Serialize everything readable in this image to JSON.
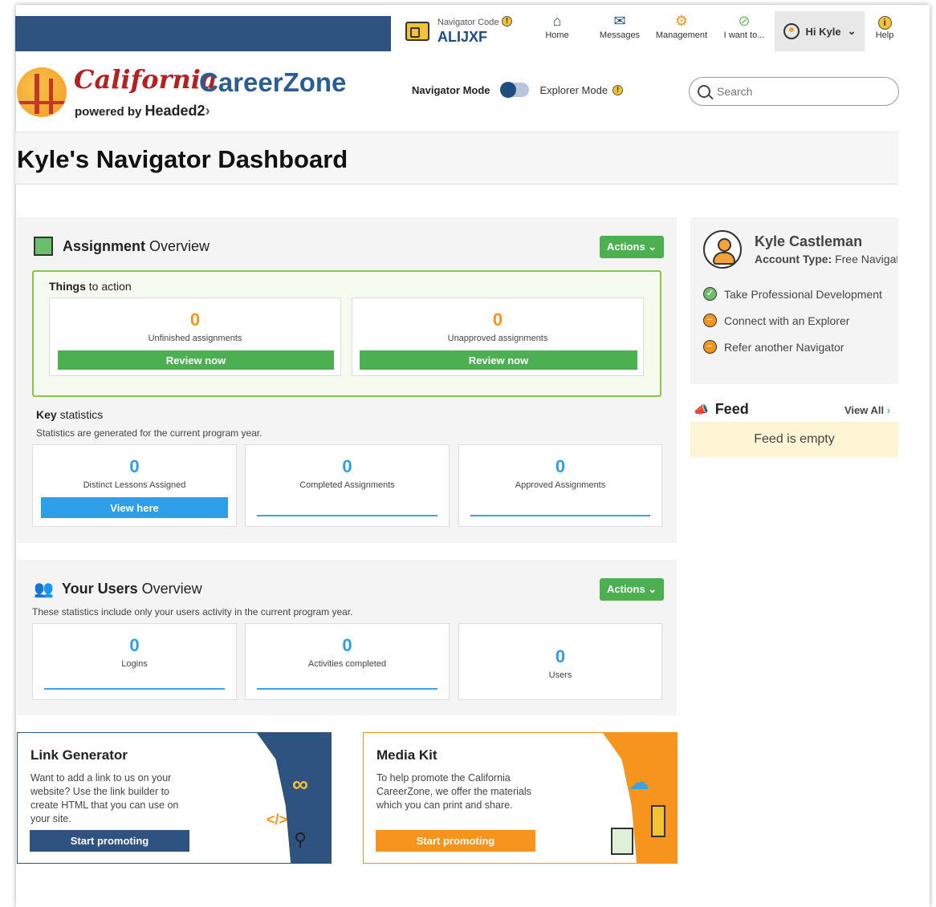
{
  "nav": {
    "code_label": "Navigator Code",
    "code_value": "ALIJXF",
    "home": "Home",
    "messages": "Messages",
    "management": "Management",
    "iwant": "I want to...",
    "greeting": "Hi Kyle",
    "help": "Help"
  },
  "brand": {
    "california": "California",
    "careerzone": "CareerZone",
    "powered_by": "powered by",
    "headed2": "Headed2"
  },
  "modes": {
    "navigator": "Navigator Mode",
    "explorer": "Explorer Mode"
  },
  "search": {
    "placeholder": "Search"
  },
  "page_title": "Kyle's Navigator Dashboard",
  "assignment": {
    "title_bold": "Assignment",
    "title_rest": "Overview",
    "actions": "Actions",
    "things_bold": "Things",
    "things_rest": "to action",
    "unfinished_value": "0",
    "unfinished_label": "Unfinished assignments",
    "unapproved_value": "0",
    "unapproved_label": "Unapproved assignments",
    "review": "Review now",
    "key_bold": "Key",
    "key_rest": "statistics",
    "key_note": "Statistics are generated for the current program year.",
    "distinct_value": "0",
    "distinct_label": "Distinct Lessons Assigned",
    "view_here": "View here",
    "completed_value": "0",
    "completed_label": "Completed Assignments",
    "approved_value": "0",
    "approved_label": "Approved Assignments"
  },
  "users": {
    "title_bold": "Your Users",
    "title_rest": "Overview",
    "actions": "Actions",
    "note": "These statistics include only your users activity in the current program year.",
    "logins_value": "0",
    "logins_label": "Logins",
    "activities_value": "0",
    "activities_label": "Activities completed",
    "users_value": "0",
    "users_label": "Users"
  },
  "profile": {
    "name": "Kyle Castleman",
    "type_label": "Account Type:",
    "type_value": "Free Navigator",
    "todo": [
      "Take Professional Development",
      "Connect with an Explorer",
      "Refer another Navigator"
    ]
  },
  "feed": {
    "title": "Feed",
    "view_all": "View All",
    "empty": "Feed is empty"
  },
  "link_gen": {
    "title": "Link Generator",
    "text": "Want to add a link to us on your website? Use the link builder to create HTML that you can use on your site.",
    "button": "Start promoting"
  },
  "media_kit": {
    "title": "Media Kit",
    "text": "To help promote the California CareerZone, we offer the materials which you can print and share.",
    "button": "Start promoting"
  },
  "colors": {
    "navy": "#2f5380",
    "green": "#4caf50",
    "orange": "#f7941d",
    "blue": "#2f9ee8"
  }
}
